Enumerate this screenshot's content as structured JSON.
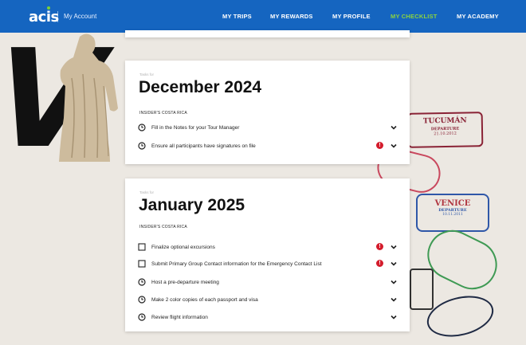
{
  "nav": {
    "logo": "acis",
    "account": "My Account",
    "items": [
      {
        "label": "MY TRIPS",
        "active": false
      },
      {
        "label": "MY REWARDS",
        "active": false
      },
      {
        "label": "MY PROFILE",
        "active": false
      },
      {
        "label": "MY CHECKLIST",
        "active": true
      },
      {
        "label": "MY ACADEMY",
        "active": false
      }
    ]
  },
  "colors": {
    "nav_bg": "#1565c0",
    "active": "#8bd33f",
    "alert": "#d41c2c"
  },
  "background": {
    "stamp_tucuman": {
      "city": "TUCUMÁN",
      "sub": "DEPARTURE",
      "date": "21.10.2012"
    },
    "stamp_venice": {
      "city": "VENICE",
      "sub": "DEPARTURE",
      "date": "10.11.2011"
    }
  },
  "sections": [
    {
      "tasks_for": "Tasks for",
      "month": "December 2024",
      "trip": "INSIDER'S COSTA RICA",
      "tasks": [
        {
          "label": "Fill in the Notes for your Tour Manager",
          "icon": "clock-icon",
          "alert": false
        },
        {
          "label": "Ensure all participants have signatures on file",
          "icon": "clock-icon",
          "alert": true
        }
      ]
    },
    {
      "tasks_for": "Tasks for",
      "month": "January 2025",
      "trip": "INSIDER'S COSTA RICA",
      "tasks": [
        {
          "label": "Finalize optional excursions",
          "icon": "checkbox-icon",
          "alert": true
        },
        {
          "label": "Submit Primary Group Contact information for the Emergency Contact List",
          "icon": "checkbox-icon",
          "alert": true
        },
        {
          "label": "Host a pre-departure meeting",
          "icon": "clock-icon",
          "alert": false
        },
        {
          "label": "Make 2 color copies of each passport and visa",
          "icon": "clock-icon",
          "alert": false
        },
        {
          "label": "Review flight information",
          "icon": "clock-icon",
          "alert": false
        }
      ]
    }
  ],
  "alert_symbol": "!"
}
